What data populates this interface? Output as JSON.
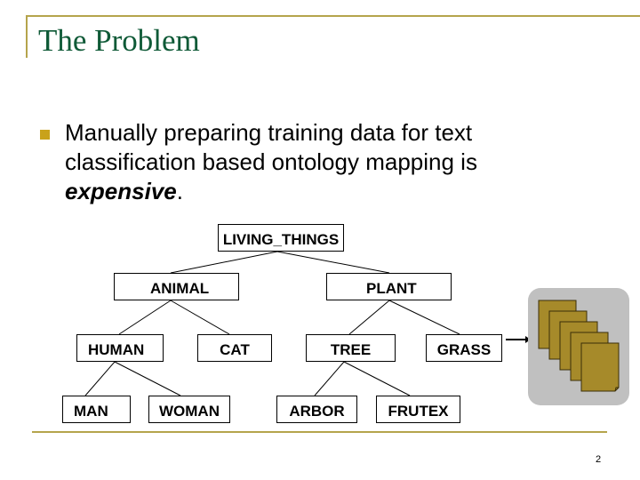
{
  "slide": {
    "title": "The Problem",
    "bullet_text": "Manually preparing training data for text classification based ontology mapping is ",
    "bullet_emphasis": "expensive",
    "bullet_end": ".",
    "page_number": "2"
  },
  "ontology": {
    "root": "LIVING_THINGS",
    "nodes": {
      "animal": "ANIMAL",
      "plant": "PLANT",
      "human": "HUMAN",
      "cat": "CAT",
      "tree": "TREE",
      "grass": "GRASS",
      "man": "MAN",
      "woman": "WOMAN",
      "arbor": "ARBOR",
      "frutex": "FRUTEX"
    }
  },
  "documents_icon": "document-stack-icon",
  "colors": {
    "title": "#0f5a37",
    "rule": "#b5a44c",
    "bullet": "#c9a21a",
    "document": "#a68a2a",
    "panel": "#c0c0c0"
  }
}
